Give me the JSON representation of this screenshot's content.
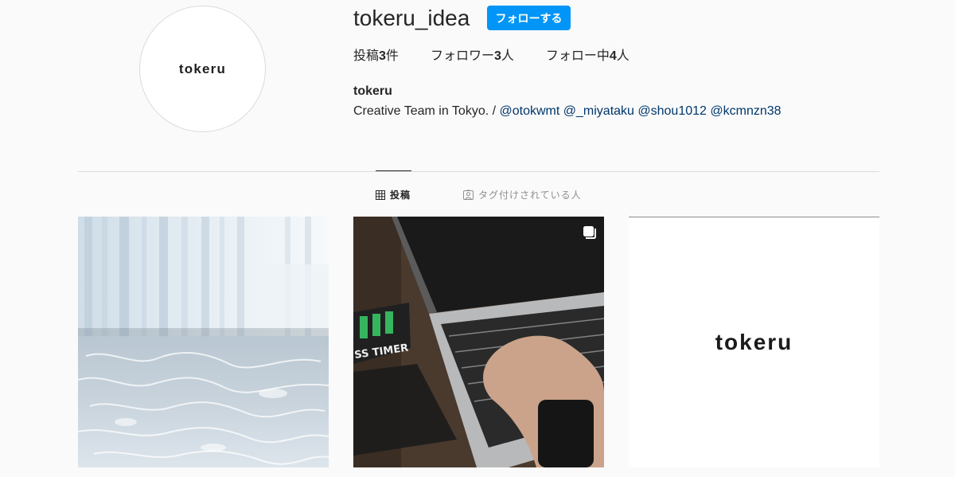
{
  "profile": {
    "avatar_text": "tokeru",
    "username": "tokeru_idea",
    "follow_button_label": "フォローする",
    "display_name": "tokeru",
    "bio_text": "Creative Team in Tokyo. / ",
    "mentions": [
      "@otokwmt",
      "@_miyataku",
      "@shou1012",
      "@kcmnzn38"
    ]
  },
  "stats": {
    "posts_label": "投稿",
    "posts_count": "3",
    "posts_unit": "件",
    "followers_label": "フォロワー",
    "followers_count": "3",
    "followers_unit": "人",
    "following_label": "フォロー中",
    "following_count": "4",
    "following_unit": "人"
  },
  "tabs": {
    "posts_label": "投稿",
    "tagged_label": "タグ付けされている人"
  },
  "posts": {
    "post_2_timer_text": "SS TIMER",
    "post_3_text": "tokeru"
  },
  "colors": {
    "accent": "#0095f6",
    "mention": "#00376b",
    "background": "#fafafa"
  }
}
